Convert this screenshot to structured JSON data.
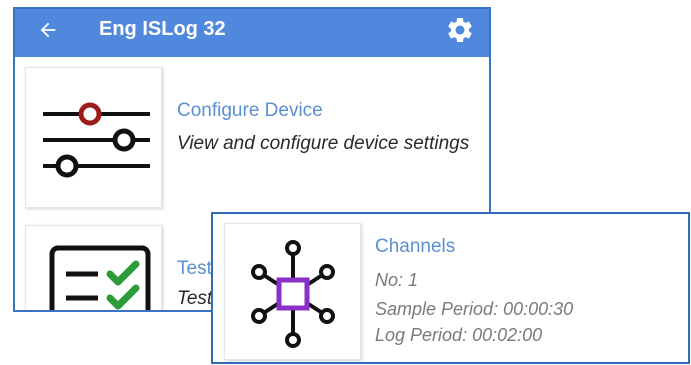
{
  "app": {
    "title": "Eng ISLog 32",
    "accent_color": "#4f88dd",
    "back_icon": "arrow-left-icon",
    "settings_icon": "gear-icon"
  },
  "rows": [
    {
      "icon": "sliders-icon",
      "title": "Configure Device",
      "subtitle": "View and configure device settings"
    },
    {
      "icon": "checklist-icon",
      "title": "Test",
      "subtitle": "Test"
    }
  ],
  "channels_card": {
    "icon": "network-hub-icon",
    "title": "Channels",
    "lines": [
      "No: 1",
      "Sample Period: 00:00:30",
      "Log Period: 00:02:00"
    ]
  }
}
